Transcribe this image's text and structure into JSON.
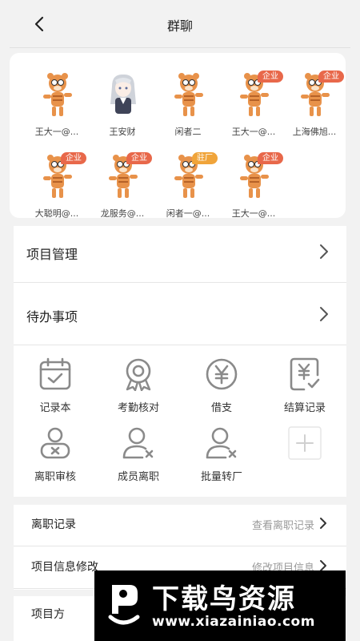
{
  "header": {
    "title": "群聊"
  },
  "members": [
    {
      "name": "王大一@...",
      "avatar": "tiger-avatar-icon",
      "badge": ""
    },
    {
      "name": "王安财",
      "avatar": "anime-avatar-icon",
      "badge": ""
    },
    {
      "name": "闲者二",
      "avatar": "tiger-avatar-icon",
      "badge": ""
    },
    {
      "name": "王大一@...",
      "avatar": "tiger-avatar-icon",
      "badge": "企业"
    },
    {
      "name": "上海佛旭...",
      "avatar": "tiger-avatar-icon",
      "badge": "企业"
    },
    {
      "name": "大聪明@...",
      "avatar": "tiger-avatar-icon",
      "badge": "企业"
    },
    {
      "name": "龙服务@...",
      "avatar": "tiger-avatar-icon",
      "badge": "企业"
    },
    {
      "name": "闲者一@...",
      "avatar": "tiger-avatar-icon",
      "badge": "驻厂"
    },
    {
      "name": "王大一@...",
      "avatar": "tiger-avatar-icon",
      "badge": "企业"
    }
  ],
  "menu": {
    "project_management": "项目管理",
    "todo": "待办事项"
  },
  "grid": [
    {
      "label": "记录本",
      "icon": "calendar-check-icon"
    },
    {
      "label": "考勤核对",
      "icon": "award-ribbon-icon"
    },
    {
      "label": "借支",
      "icon": "yen-coin-icon"
    },
    {
      "label": "结算记录",
      "icon": "yen-document-icon"
    },
    {
      "label": "离职审核",
      "icon": "user-x-card-icon"
    },
    {
      "label": "成员离职",
      "icon": "user-remove-icon"
    },
    {
      "label": "批量转厂",
      "icon": "user-transfer-icon"
    },
    {
      "label": "",
      "icon": "plus-add-icon"
    }
  ],
  "settings": {
    "leave_record": {
      "label": "离职记录",
      "action": "查看离职记录"
    },
    "project_info": {
      "label": "项目信息修改",
      "action": "修改项目信息"
    },
    "project_party": {
      "label": "项目方"
    }
  },
  "watermark": {
    "text": "下载鸟资源",
    "url": "www.xiazainiao.com"
  },
  "colors": {
    "badge_enterprise": "#e8684a",
    "badge_onsite": "#f0a43a",
    "icon_gray": "#8a8a8a",
    "tiger": "#e8924a"
  }
}
